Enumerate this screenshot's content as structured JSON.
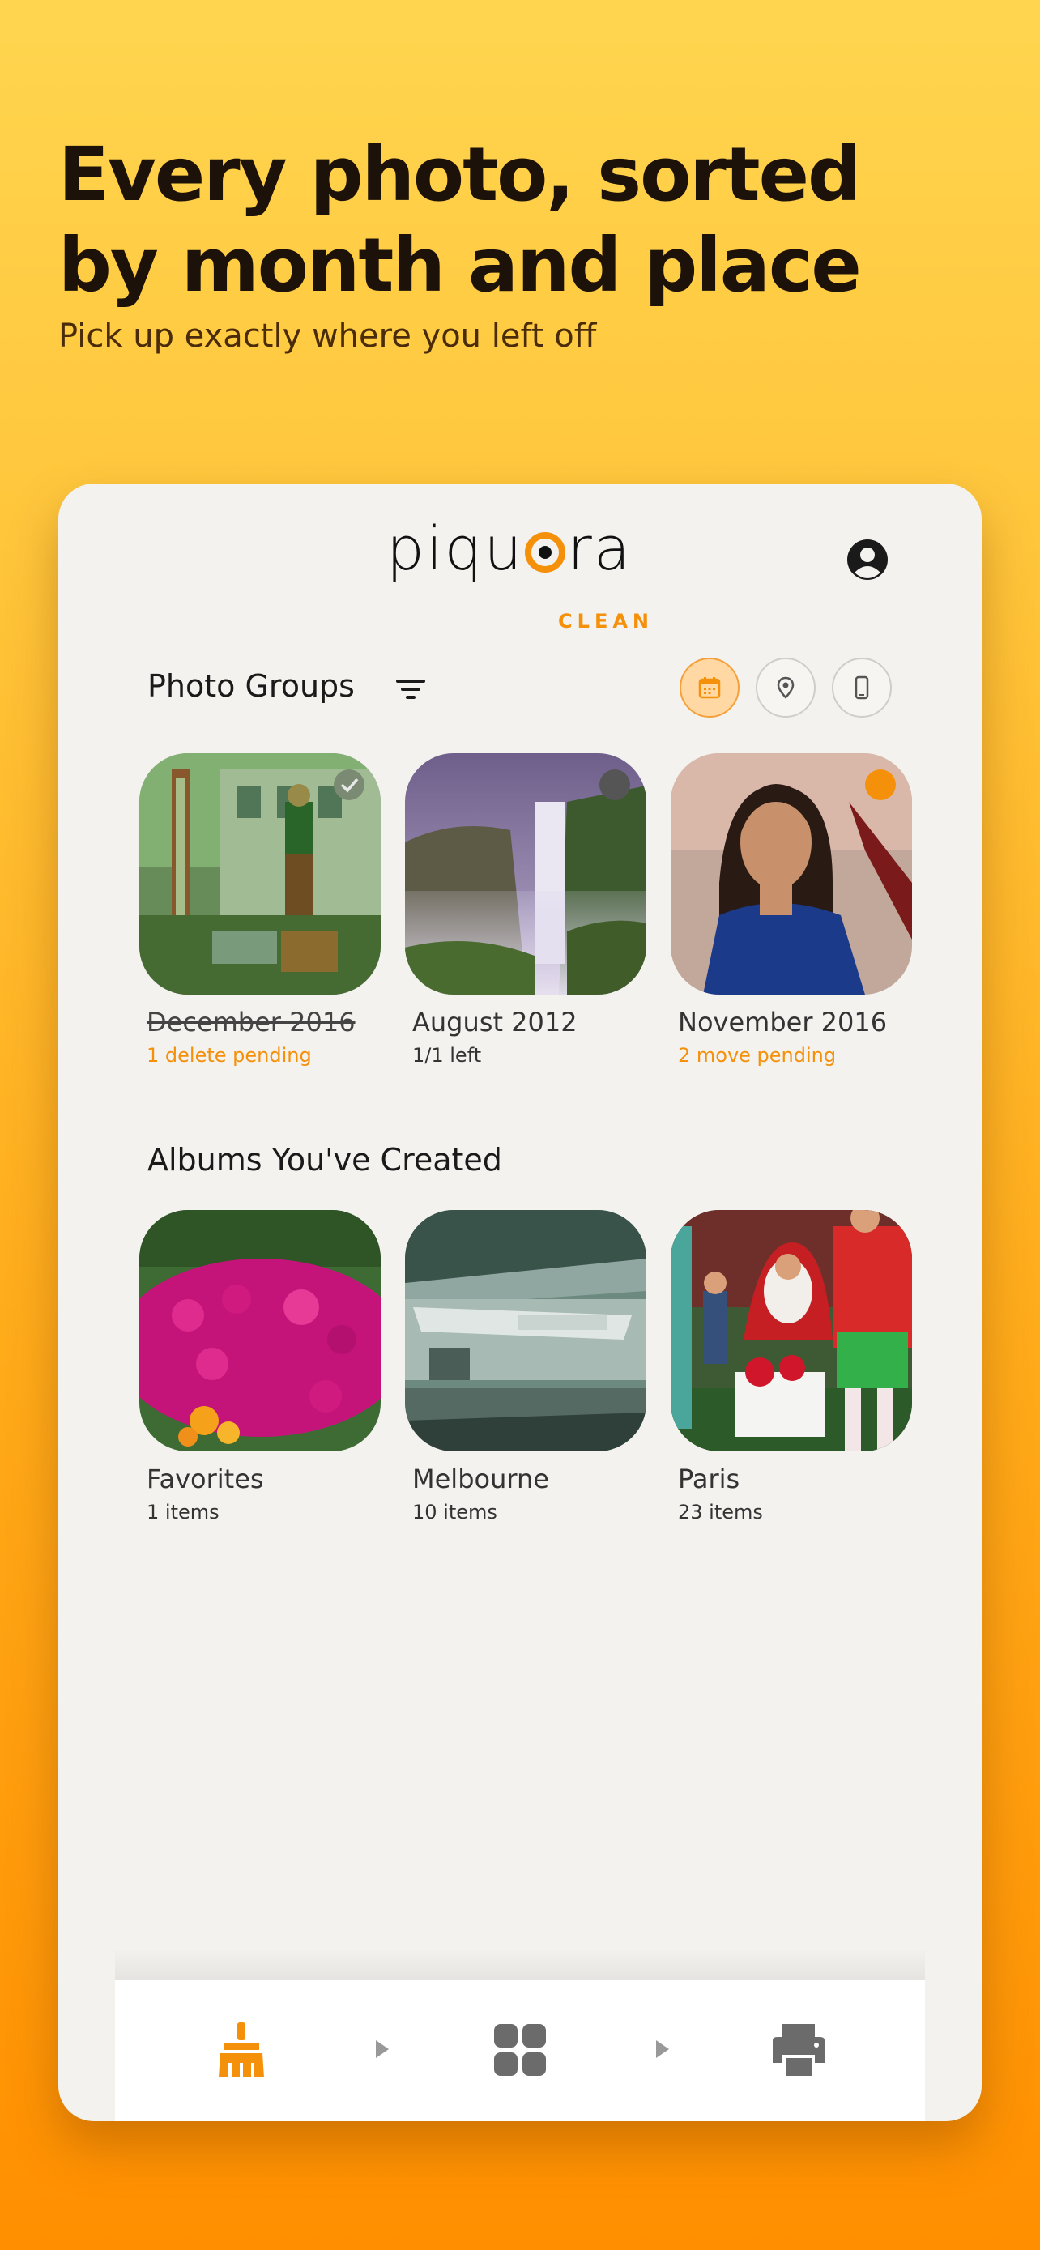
{
  "headline": {
    "line1": "Every photo, sorted",
    "line2": "by month and place",
    "subtitle": "Pick up exactly where you left off"
  },
  "logo": {
    "word_left": "piqu",
    "word_right": "ra",
    "sub": "CLEAN"
  },
  "photo_groups": {
    "title": "Photo Groups",
    "view_modes": [
      "calendar-icon",
      "location-pin-icon",
      "phone-icon"
    ],
    "active_view": "calendar",
    "items": [
      {
        "name": "December 2016",
        "status": "1 delete pending",
        "status_color": "#f5900a",
        "badge": "checked",
        "crossed": true
      },
      {
        "name": "August 2012",
        "status": "1/1 left",
        "status_color": "#333333",
        "badge": "gray"
      },
      {
        "name": "November 2016",
        "status": "2 move pending",
        "status_color": "#f5900a",
        "badge": "orange"
      }
    ]
  },
  "albums": {
    "title": "Albums You've Created",
    "items": [
      {
        "name": "Favorites",
        "count": "1 items"
      },
      {
        "name": "Melbourne",
        "count": "10 items"
      },
      {
        "name": "Paris",
        "count": "23 items"
      }
    ]
  },
  "bottom_nav": {
    "items": [
      "broom-icon",
      "grid-icon",
      "printer-icon"
    ],
    "active": "broom-icon"
  },
  "colors": {
    "accent": "#f5900a",
    "card_bg": "#f3f2ef"
  }
}
